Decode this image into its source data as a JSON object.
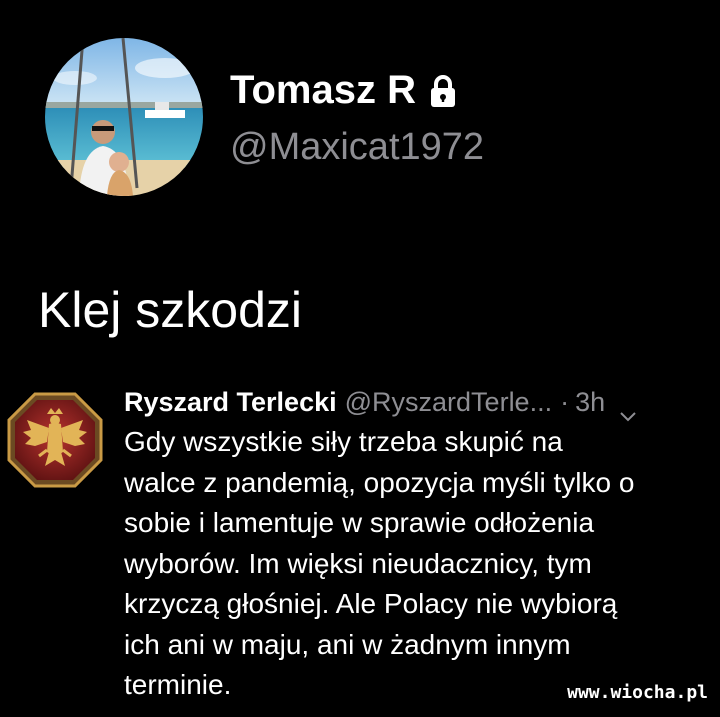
{
  "profile": {
    "display_name": "Tomasz R",
    "handle": "@Maxicat1972",
    "locked_icon": "lock-icon",
    "avatar_icon": "profile-photo-beach"
  },
  "tweet": {
    "text": "Klej szkodzi"
  },
  "quoted_tweet": {
    "author_name": "Ryszard Terlecki",
    "author_handle": "@RyszardTerle...",
    "separator": "·",
    "time": "3h",
    "avatar_icon": "eagle-emblem-icon",
    "menu_icon": "chevron-down-icon",
    "lines": [
      "Gdy wszystkie siły trzeba skupić na",
      "walce z pandemią, opozycja myśli tylko o",
      "sobie i lamentuje w sprawie odłożenia",
      "wyborów. Im więksi nieudacznicy, tym",
      "krzyczą głośniej. Ale Polacy nie wybiorą",
      "ich ani w maju, ani w żadnym innym",
      "terminie."
    ]
  },
  "watermark": {
    "text": "www.wiocha.pl"
  },
  "colors": {
    "background": "#000000",
    "primary_text": "#ffffff",
    "secondary_text": "#8e8e93",
    "emblem_red": "#8b1e1e",
    "emblem_gold": "#d4a94a"
  }
}
